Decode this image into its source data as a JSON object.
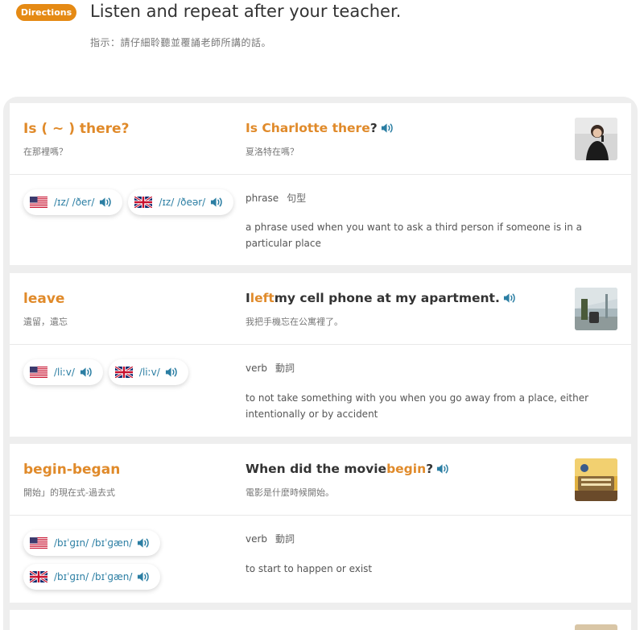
{
  "header": {
    "badge": "Directions",
    "title": "Listen and repeat after your teacher.",
    "subtitle": "指示：請仔細聆聽並覆誦老師所講的話。"
  },
  "cards": [
    {
      "word": "Is ( ~ ) there?",
      "word_translation": "在那裡嗎？",
      "sentence_pre": "Is Charlotte there",
      "sentence_highlight": "",
      "sentence_post": "?",
      "sentence_translation": "夏洛特在嗎？",
      "pron_us": "/ɪz/ /ðer/",
      "pron_uk": "/ɪz/ /ðeər/",
      "pos": "phrase",
      "pos_zh": "句型",
      "definition": "a phrase used when you want to ask a third person if someone is in a particular place"
    },
    {
      "word": "leave",
      "word_translation": "遺留，遺忘",
      "sentence_pre": "I ",
      "sentence_highlight": "left",
      "sentence_post": " my cell phone at my apartment.",
      "sentence_translation": "我把手機忘在公寓裡了。",
      "pron_us": "/liːv/",
      "pron_uk": "/liːv/",
      "pos": "verb",
      "pos_zh": "動詞",
      "definition": "to not take something with you when you go away from a place, either intentionally or by accident"
    },
    {
      "word": "begin-began",
      "word_translation": "開始」的現在式-過去式",
      "sentence_pre": "When did the movie ",
      "sentence_highlight": "begin",
      "sentence_post": "?",
      "sentence_translation": "電影是什麼時候開始。",
      "pron_us": "/bɪˈɡɪn/ /bɪˈɡæn/",
      "pron_uk": "/bɪˈɡɪn/ /bɪˈɡæn/",
      "pos": "verb",
      "pos_zh": "動詞",
      "definition": "to start to happen or exist"
    }
  ],
  "colors": {
    "accent": "#e58a14",
    "word": "#e08a2a",
    "pronunciation": "#2b7ea3",
    "panel": "#eeeeee"
  },
  "icons": {
    "speaker": "speaker-icon",
    "us_flag": "us-flag-icon",
    "uk_flag": "uk-flag-icon"
  }
}
